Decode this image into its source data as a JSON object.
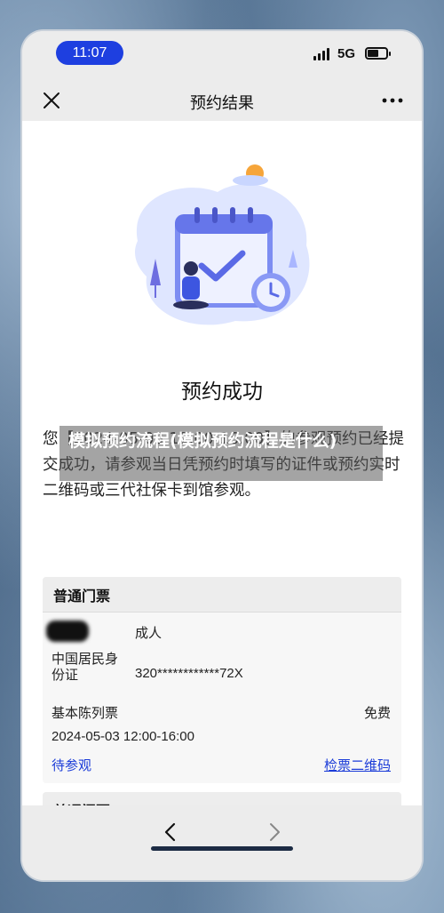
{
  "status_bar": {
    "time": "11:07",
    "network": "5G",
    "battery_level": 0.6
  },
  "nav": {
    "title": "预约结果",
    "close_icon": "close-icon",
    "more_icon": "more-icon"
  },
  "result": {
    "title": "预约成功",
    "message": "您【2024-05-03 12:00-16:00】的参观预约已经提交成功，请参观当日凭预约时填写的证件或预约实时二维码或三代社保卡到馆参观。"
  },
  "watermark": "模拟预约流程(模拟预约流程是什么)",
  "tickets": [
    {
      "header": "普通门票",
      "visitor_type": "成人",
      "id_type": "中国居民身份证",
      "id_number": "320************72X",
      "exhibit": "基本陈列票",
      "price": "免费",
      "datetime": "2024-05-03 12:00-16:00",
      "status": "待参观",
      "qr_link": "检票二维码"
    },
    {
      "header": "普通门票"
    }
  ],
  "bottom_nav": {
    "back_icon": "chevron-left-icon",
    "forward_icon": "chevron-right-icon"
  },
  "colors": {
    "accent": "#1a3bd8",
    "time_pill": "#1e3fe0"
  }
}
